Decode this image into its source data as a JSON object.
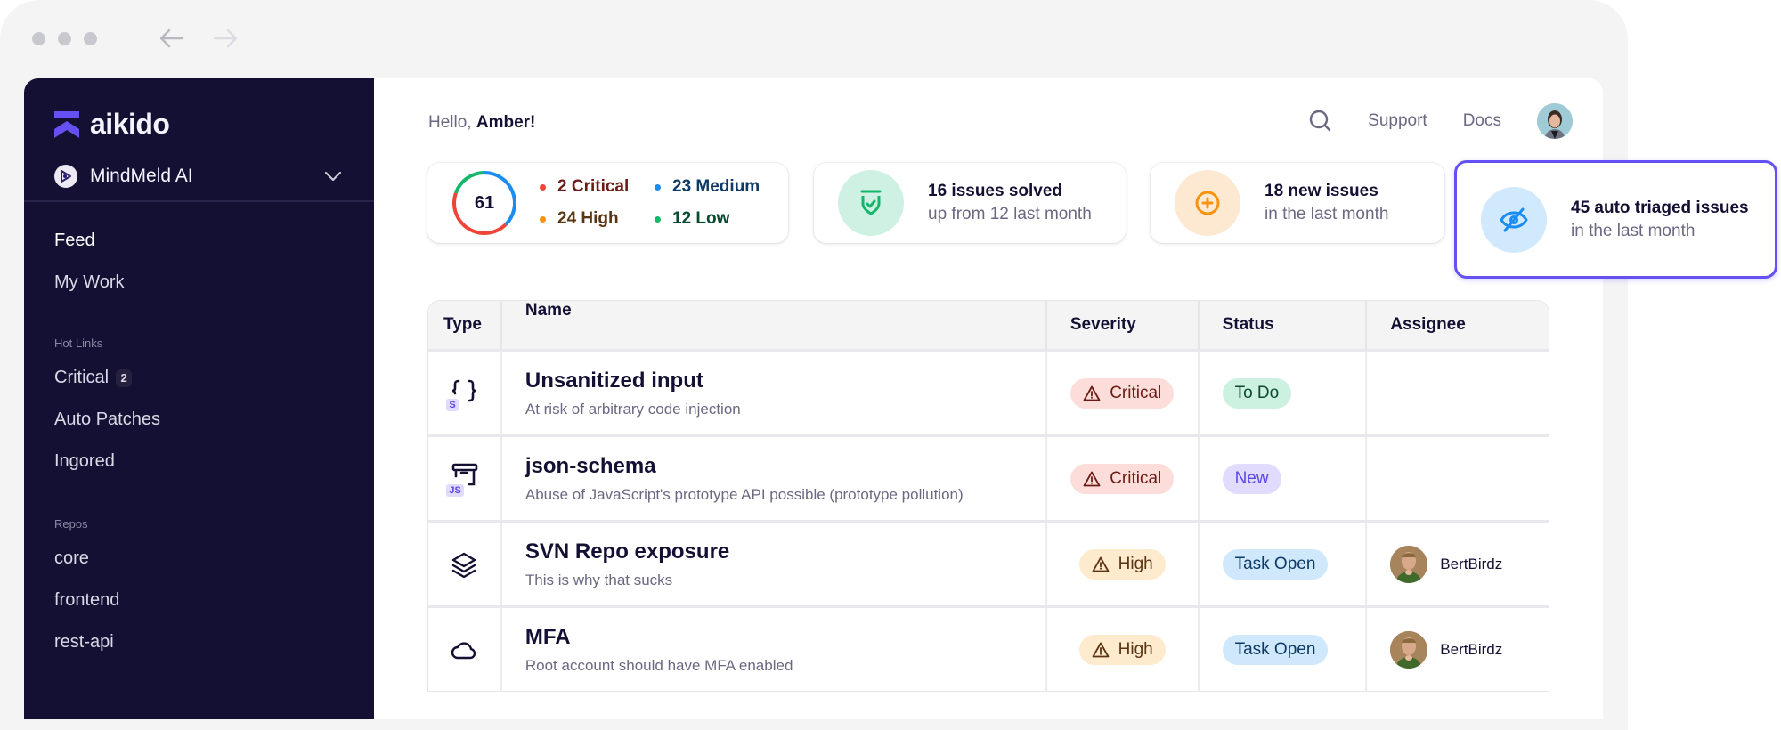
{
  "browser": {
    "back_icon": "arrow-left-icon",
    "forward_icon": "arrow-right-icon"
  },
  "sidebar": {
    "logo_text": "aikido",
    "workspace": {
      "name": "MindMeld AI",
      "icon": "workspace-logo-icon",
      "chevron": "chevron-down-icon"
    },
    "primary": [
      {
        "label": "Feed",
        "active": true
      },
      {
        "label": "My Work",
        "active": false
      }
    ],
    "hot_links": {
      "title": "Hot Links",
      "items": [
        {
          "label": "Critical",
          "badge": "2"
        },
        {
          "label": "Auto Patches"
        },
        {
          "label": "Ingored"
        }
      ]
    },
    "repos": {
      "title": "Repos",
      "items": [
        {
          "label": "core"
        },
        {
          "label": "frontend"
        },
        {
          "label": "rest-api"
        }
      ]
    }
  },
  "header": {
    "greeting_prefix": "Hello,",
    "user_name": "Amber!",
    "links": {
      "support": "Support",
      "docs": "Docs"
    }
  },
  "summary": {
    "total": "61",
    "breakdown": [
      {
        "label": "2 Critical",
        "count": 2,
        "dot": "#f04438",
        "text_color": "#6b1b14"
      },
      {
        "label": "23 Medium",
        "count": 23,
        "dot": "#1b8cf0",
        "text_color": "#0d3a66"
      },
      {
        "label": "24 High",
        "count": 24,
        "dot": "#f7930f",
        "text_color": "#5b3412"
      },
      {
        "label": "12 Low",
        "count": 12,
        "dot": "#12b76a",
        "text_color": "#0a4a2e"
      }
    ]
  },
  "stat_cards": [
    {
      "title": "16 issues solved",
      "subtitle": "up from 12 last month",
      "icon": "shield-check-icon",
      "bg": "#cff1e3",
      "fg": "#12b76a"
    },
    {
      "title": "18 new issues",
      "subtitle": "in the last month",
      "icon": "plus-circle-icon",
      "bg": "#fde9d2",
      "fg": "#f7930f"
    },
    {
      "title": "45 auto triaged issues",
      "subtitle": "in the last month",
      "icon": "eye-off-icon",
      "bg": "#d1e9fd",
      "fg": "#1b8cf0",
      "highlighted": true
    }
  ],
  "table": {
    "columns": [
      "Type",
      "Name",
      "Severity",
      "Status",
      "Assignee"
    ],
    "rows": [
      {
        "type_icon": "code-braces-icon",
        "lang": "S",
        "title": "Unsanitized input",
        "subtitle": "At risk of arbitrary code injection",
        "severity": "Critical",
        "status": "To Do",
        "assignee": ""
      },
      {
        "type_icon": "package-icon",
        "lang": "JS",
        "title": "json-schema",
        "subtitle": "Abuse of JavaScript's prototype API possible (prototype pollution)",
        "severity": "Critical",
        "status": "New",
        "assignee": ""
      },
      {
        "type_icon": "layers-icon",
        "lang": "",
        "title": "SVN Repo exposure",
        "subtitle": "This is why that sucks",
        "severity": "High",
        "status": "Task Open",
        "assignee": "BertBirdz"
      },
      {
        "type_icon": "cloud-icon",
        "lang": "",
        "title": "MFA",
        "subtitle": "Root account should have MFA enabled",
        "severity": "High",
        "status": "Task Open",
        "assignee": "BertBirdz"
      }
    ]
  }
}
